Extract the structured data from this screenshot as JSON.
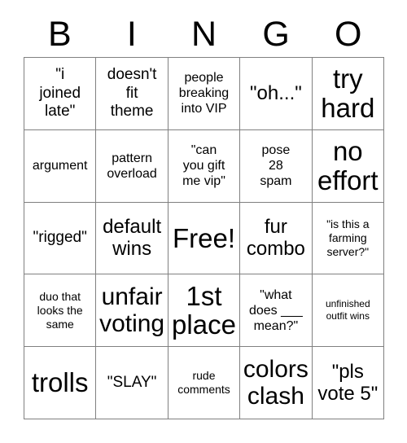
{
  "card": {
    "title": "BINGO",
    "header_letters": [
      "B",
      "I",
      "N",
      "G",
      "O"
    ],
    "free_space_label": "Free!",
    "colors": {
      "background": "#ffffff",
      "grid_line": "#808080",
      "text": "#000000"
    },
    "rows": [
      [
        {
          "text": "\"i\njoined\nlate\"",
          "size": "fs-l"
        },
        {
          "text": "doesn't\nfit\ntheme",
          "size": "fs-l"
        },
        {
          "text": "people\nbreaking\ninto VIP",
          "size": "fs-m"
        },
        {
          "text": "\"oh...\"",
          "size": "fs-xl"
        },
        {
          "text": "try\nhard",
          "size": "fs-3xl"
        }
      ],
      [
        {
          "text": "argument",
          "size": "fs-m"
        },
        {
          "text": "pattern\noverload",
          "size": "fs-m"
        },
        {
          "text": "\"can\nyou gift\nme vip\"",
          "size": "fs-m"
        },
        {
          "text": "pose\n28\nspam",
          "size": "fs-m"
        },
        {
          "text": "no\neffort",
          "size": "fs-3xl"
        }
      ],
      [
        {
          "text": "\"rigged\"",
          "size": "fs-l"
        },
        {
          "text": "default\nwins",
          "size": "fs-xl"
        },
        {
          "text": "Free!",
          "size": "fs-3xl"
        },
        {
          "text": "fur\ncombo",
          "size": "fs-xl"
        },
        {
          "text": "\"is this a\nfarming\nserver?\"",
          "size": "fs-s"
        }
      ],
      [
        {
          "text": "duo that\nlooks the\nsame",
          "size": "fs-s"
        },
        {
          "text": "unfair\nvoting",
          "size": "fs-xxl"
        },
        {
          "text": "1st\nplace",
          "size": "fs-3xl"
        },
        {
          "text": "\"what\ndoes ___\nmean?\"",
          "size": "fs-m"
        },
        {
          "text": "unfinished\noutfit wins",
          "size": "fs-xs"
        }
      ],
      [
        {
          "text": "trolls",
          "size": "fs-3xl"
        },
        {
          "text": "\"SLAY\"",
          "size": "fs-l"
        },
        {
          "text": "rude\ncomments",
          "size": "fs-s"
        },
        {
          "text": "colors\nclash",
          "size": "fs-xxl"
        },
        {
          "text": "\"pls\nvote 5\"",
          "size": "fs-xl"
        }
      ]
    ]
  }
}
